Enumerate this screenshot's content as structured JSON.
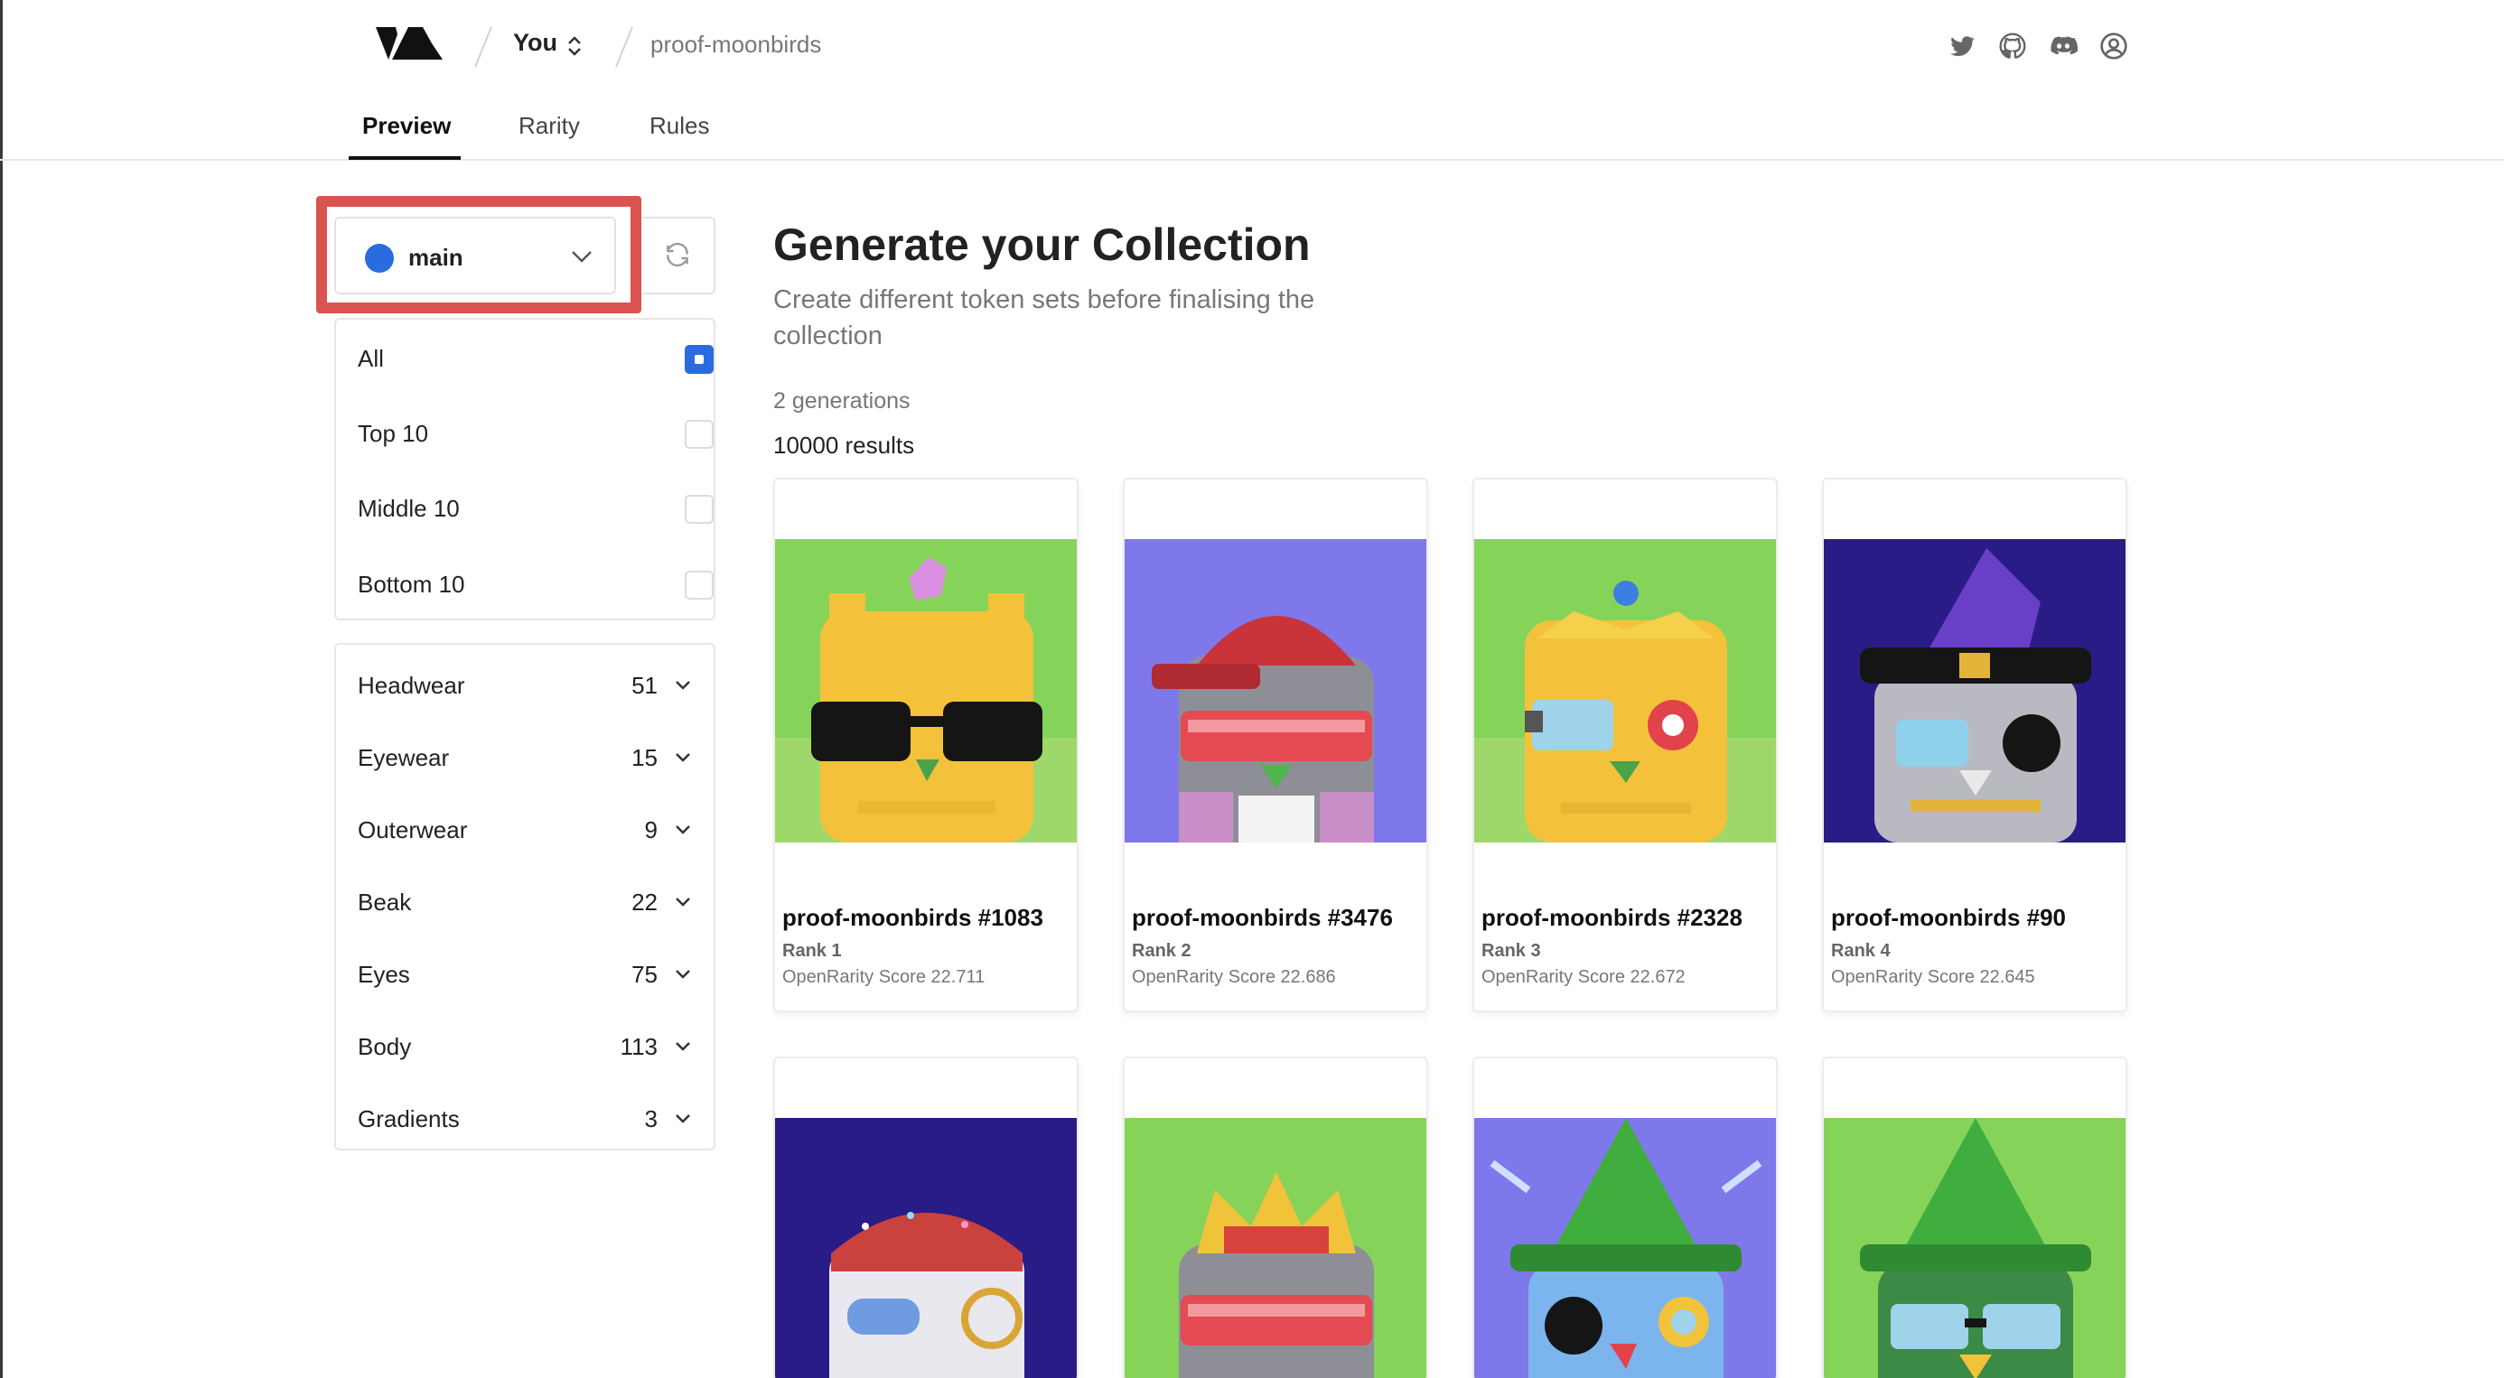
{
  "header": {
    "breadcrumb": {
      "user": "You",
      "project": "proof-moonbirds"
    },
    "social_icons": [
      "twitter-icon",
      "github-icon",
      "discord-icon",
      "account-icon"
    ],
    "tabs": [
      {
        "label": "Preview",
        "active": true
      },
      {
        "label": "Rarity",
        "active": false
      },
      {
        "label": "Rules",
        "active": false
      }
    ]
  },
  "sidebar": {
    "branch": {
      "label": "main",
      "dot_color": "#2b6be0"
    },
    "filters": [
      {
        "label": "All",
        "checked": true
      },
      {
        "label": "Top 10",
        "checked": false
      },
      {
        "label": "Middle 10",
        "checked": false
      },
      {
        "label": "Bottom 10",
        "checked": false
      }
    ],
    "traits": [
      {
        "label": "Headwear",
        "count": "51"
      },
      {
        "label": "Eyewear",
        "count": "15"
      },
      {
        "label": "Outerwear",
        "count": "9"
      },
      {
        "label": "Beak",
        "count": "22"
      },
      {
        "label": "Eyes",
        "count": "75"
      },
      {
        "label": "Body",
        "count": "113"
      },
      {
        "label": "Gradients",
        "count": "3"
      }
    ]
  },
  "main": {
    "title": "Generate your Collection",
    "subtitle": "Create different token sets before finalising the collection",
    "generations": "2 generations",
    "results": "10000 results",
    "cards": [
      {
        "name": "proof-moonbirds #1083",
        "rank": "Rank 1",
        "score": "OpenRarity Score 22.711"
      },
      {
        "name": "proof-moonbirds #3476",
        "rank": "Rank 2",
        "score": "OpenRarity Score 22.686"
      },
      {
        "name": "proof-moonbirds #2328",
        "rank": "Rank 3",
        "score": "OpenRarity Score 22.672"
      },
      {
        "name": "proof-moonbirds #90",
        "rank": "Rank 4",
        "score": "OpenRarity Score 22.645"
      }
    ],
    "highlight_color": "#d9544f"
  }
}
